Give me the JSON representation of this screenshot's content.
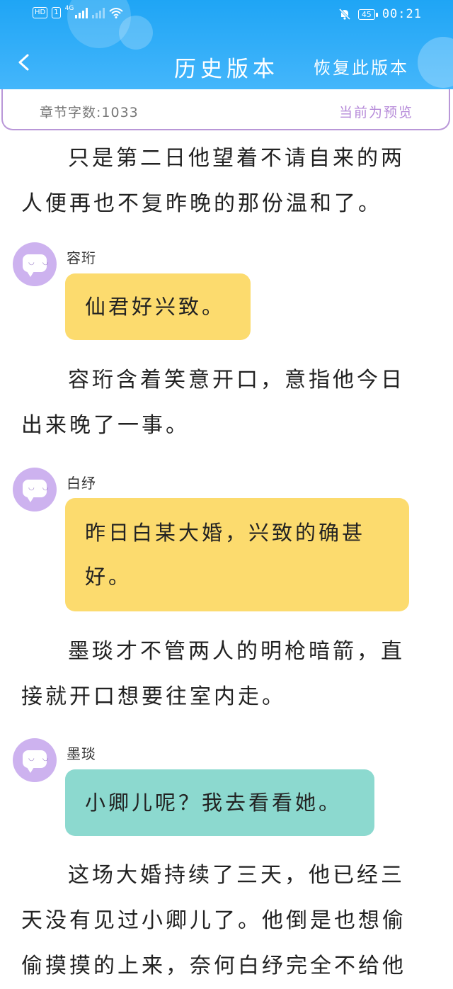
{
  "status_bar": {
    "network_badge": "HD",
    "sim": "1",
    "signal_type": "4G",
    "battery": "45",
    "time": "00:21"
  },
  "header": {
    "title": "历史版本",
    "restore_label": "恢复此版本",
    "background_color": "#2aa9f7"
  },
  "info": {
    "word_count": "章节字数:1033",
    "preview_label": "当前为预览"
  },
  "content": {
    "para1": "只是第二日他望着不请自来的两人便再也不复昨晚的那份温和了。",
    "speaker1": "容珩",
    "msg1": "仙君好兴致。",
    "para2": "容珩含着笑意开口，意指他今日出来晚了一事。",
    "speaker2": "白纾",
    "msg2": "昨日白某大婚，兴致的确甚好。",
    "para3": "墨琰才不管两人的明枪暗箭，直接就开口想要往室内走。",
    "speaker3": "墨琰",
    "msg3": "小卿儿呢？我去看看她。",
    "para4": "这场大婚持续了三天，他已经三天没有见过小卿儿了。他倒是也想偷偷摸摸的上来，奈何白纾完全不给他"
  },
  "colors": {
    "bubble_yellow": "#fcdb6e",
    "bubble_teal": "#8cd9cf",
    "avatar": "#cdb2ef",
    "preview_text": "#b68ad9"
  }
}
